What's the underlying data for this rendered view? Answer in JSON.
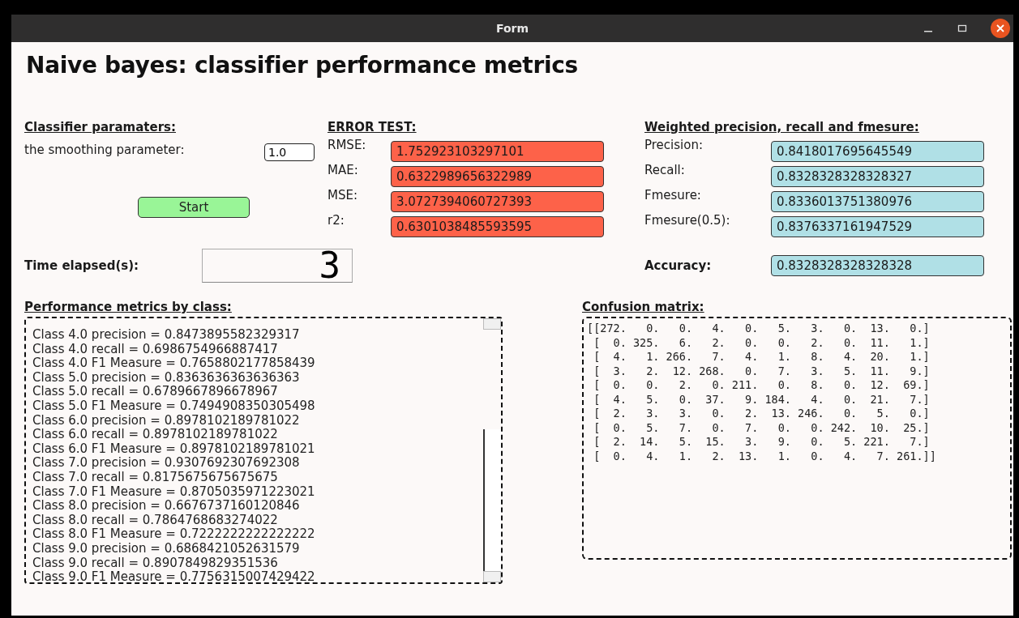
{
  "window": {
    "title": "Form"
  },
  "heading": "Naive bayes: classifier performance metrics",
  "classifier_parameters": {
    "title": "Classifier paramaters:",
    "fields": [
      {
        "label": "the smoothing parameter:",
        "value": "1.0"
      }
    ],
    "start_button": "Start"
  },
  "error_test": {
    "title": "ERROR TEST:",
    "metrics": [
      {
        "label": "RMSE:",
        "value": "1.752923103297101"
      },
      {
        "label": "MAE:",
        "value": "0.6322989656322989"
      },
      {
        "label": "MSE:",
        "value": "3.0727394060727393"
      },
      {
        "label": "r2:",
        "value": "0.6301038485593595"
      }
    ]
  },
  "weighted": {
    "title": "Weighted precision, recall and fmesure:",
    "metrics": [
      {
        "label": "Precision:",
        "value": "0.8418017695645549"
      },
      {
        "label": "Recall:",
        "value": "0.8328328328328327"
      },
      {
        "label": "Fmesure:",
        "value": "0.8336013751380976"
      },
      {
        "label": "Fmesure(0.5):",
        "value": "0.8376337161947529"
      }
    ]
  },
  "time_elapsed": {
    "label": "Time elapsed(s):",
    "value": "3"
  },
  "accuracy": {
    "label": "Accuracy:",
    "value": "0.8328328328328328"
  },
  "class_metrics": {
    "title": "Performance metrics by class:",
    "lines": [
      "Class 4.0 precision = 0.8473895582329317",
      "Class 4.0 recall = 0.6986754966887417",
      "Class 4.0 F1 Measure = 0.7658802177858439",
      "Class 5.0 precision = 0.8363636363636363",
      "Class 5.0 recall = 0.6789667896678967",
      "Class 5.0 F1 Measure = 0.7494908350305498",
      "Class 6.0 precision = 0.8978102189781022",
      "Class 6.0 recall = 0.8978102189781022",
      "Class 6.0 F1 Measure = 0.8978102189781021",
      "Class 7.0 precision = 0.9307692307692308",
      "Class 7.0 recall = 0.8175675675675675",
      "Class 7.0 F1 Measure = 0.8705035971223021",
      "Class 8.0 precision = 0.6676737160120846",
      "Class 8.0 recall = 0.7864768683274022",
      "Class 8.0 F1 Measure = 0.7222222222222222",
      "Class 9.0 precision = 0.6868421052631579",
      "Class 9.0 recall = 0.8907849829351536",
      "Class 9.0 F1 Measure = 0.7756315007429422"
    ]
  },
  "confusion_matrix": {
    "title": "Confusion matrix:",
    "rows": [
      "[[272.   0.   0.   4.   0.   5.   3.   0.  13.   0.]",
      " [  0. 325.   6.   2.   0.   0.   2.   0.  11.   1.]",
      " [  4.   1. 266.   7.   4.   1.   8.   4.  20.   1.]",
      " [  3.   2.  12. 268.   0.   7.   3.   5.  11.   9.]",
      " [  0.   0.   2.   0. 211.   0.   8.   0.  12.  69.]",
      " [  4.   5.   0.  37.   9. 184.   4.   0.  21.   7.]",
      " [  2.   3.   3.   0.   2.  13. 246.   0.   5.   0.]",
      " [  0.   5.   7.   0.   7.   0.   0. 242.  10.  25.]",
      " [  2.  14.   5.  15.   3.   9.   0.   5. 221.   7.]",
      " [  0.   4.   1.   2.  13.   1.   0.   4.   7. 261.]]"
    ]
  }
}
